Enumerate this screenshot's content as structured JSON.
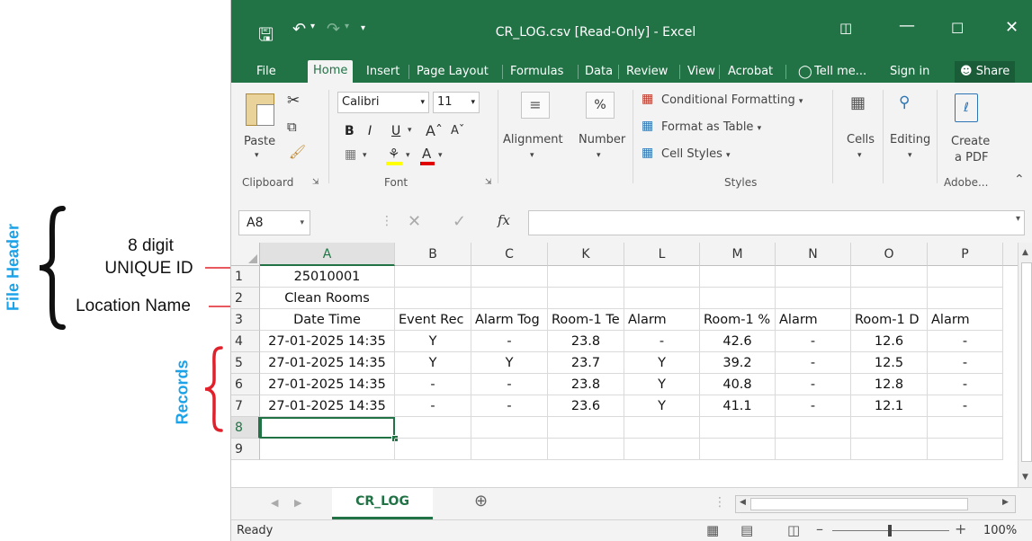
{
  "annotations": {
    "file_header": "File Header",
    "records": "Records",
    "unique_id_line1": "8 digit",
    "unique_id_line2": "UNIQUE ID",
    "location_name": "Location Name"
  },
  "window": {
    "title": "CR_LOG.csv  [Read-Only] - Excel",
    "accent": "#217346"
  },
  "tabs": [
    "File",
    "Home",
    "Insert",
    "Page Layout",
    "Formulas",
    "Data",
    "Review",
    "View",
    "Acrobat",
    "Tell me...",
    "Sign in",
    "Share"
  ],
  "ribbon": {
    "paste": "Paste",
    "clipboard": "Clipboard",
    "font_name": "Calibri",
    "font_size": "11",
    "bold": "B",
    "italic": "I",
    "underline": "U",
    "font_group": "Font",
    "alignment": "Alignment",
    "number": "Number",
    "percent": "%",
    "conditional_formatting": "Conditional Formatting",
    "format_as_table": "Format as Table",
    "cell_styles": "Cell Styles",
    "styles_group": "Styles",
    "cells": "Cells",
    "editing": "Editing",
    "create_pdf_line1": "Create",
    "create_pdf_line2": "a PDF",
    "adobe_group": "Adobe..."
  },
  "formula_bar": {
    "name_box": "A8",
    "fx": "fx",
    "formula": ""
  },
  "grid": {
    "columns": [
      "A",
      "B",
      "C",
      "K",
      "L",
      "M",
      "N",
      "O",
      "P"
    ],
    "row_numbers": [
      "1",
      "2",
      "3",
      "4",
      "5",
      "6",
      "7",
      "8",
      "9"
    ],
    "rows": [
      [
        "25010001",
        "",
        "",
        "",
        "",
        "",
        "",
        "",
        ""
      ],
      [
        "Clean Rooms",
        "",
        "",
        "",
        "",
        "",
        "",
        "",
        ""
      ],
      [
        "Date Time",
        "Event Rec",
        "Alarm Tog",
        "Room-1 Te",
        "Alarm",
        "Room-1 %",
        "Alarm",
        "Room-1 D",
        "Alarm"
      ],
      [
        "27-01-2025 14:35",
        "Y",
        "-",
        "23.8",
        "-",
        "42.6",
        "-",
        "12.6",
        "-"
      ],
      [
        "27-01-2025 14:35",
        "Y",
        "Y",
        "23.7",
        "Y",
        "39.2",
        "-",
        "12.5",
        "-"
      ],
      [
        "27-01-2025 14:35",
        "-",
        "-",
        "23.8",
        "Y",
        "40.8",
        "-",
        "12.8",
        "-"
      ],
      [
        "27-01-2025 14:35",
        "-",
        "-",
        "23.6",
        "Y",
        "41.1",
        "-",
        "12.1",
        "-"
      ],
      [
        "",
        "",
        "",
        "",
        "",
        "",
        "",
        "",
        ""
      ],
      [
        "",
        "",
        "",
        "",
        "",
        "",
        "",
        "",
        ""
      ]
    ]
  },
  "sheet_tab": "CR_LOG",
  "status": {
    "ready": "Ready",
    "zoom": "100%"
  }
}
